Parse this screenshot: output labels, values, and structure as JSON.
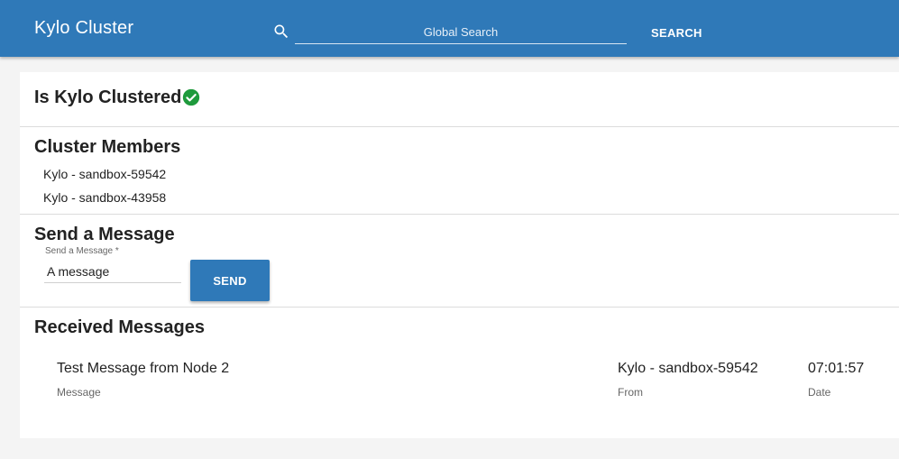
{
  "header": {
    "app_title": "Kylo Cluster",
    "search_placeholder": "Global Search",
    "search_button": "SEARCH",
    "brand_color": "#2f79b8"
  },
  "clustered": {
    "title": "Is Kylo Clustered",
    "status_icon": "check-circle-icon",
    "status_color": "#1e9a3c"
  },
  "members": {
    "title": "Cluster Members",
    "items": [
      "Kylo - sandbox-59542",
      "Kylo - sandbox-43958"
    ]
  },
  "send": {
    "title": "Send a Message",
    "field_label": "Send a Message *",
    "field_value": "A message",
    "button_label": "SEND"
  },
  "received": {
    "title": "Received Messages",
    "messages": [
      {
        "message": "Test Message from Node 2",
        "message_caption": "Message",
        "from": "Kylo - sandbox-59542",
        "from_caption": "From",
        "date": "07:01:57",
        "date_caption": "Date"
      }
    ]
  }
}
